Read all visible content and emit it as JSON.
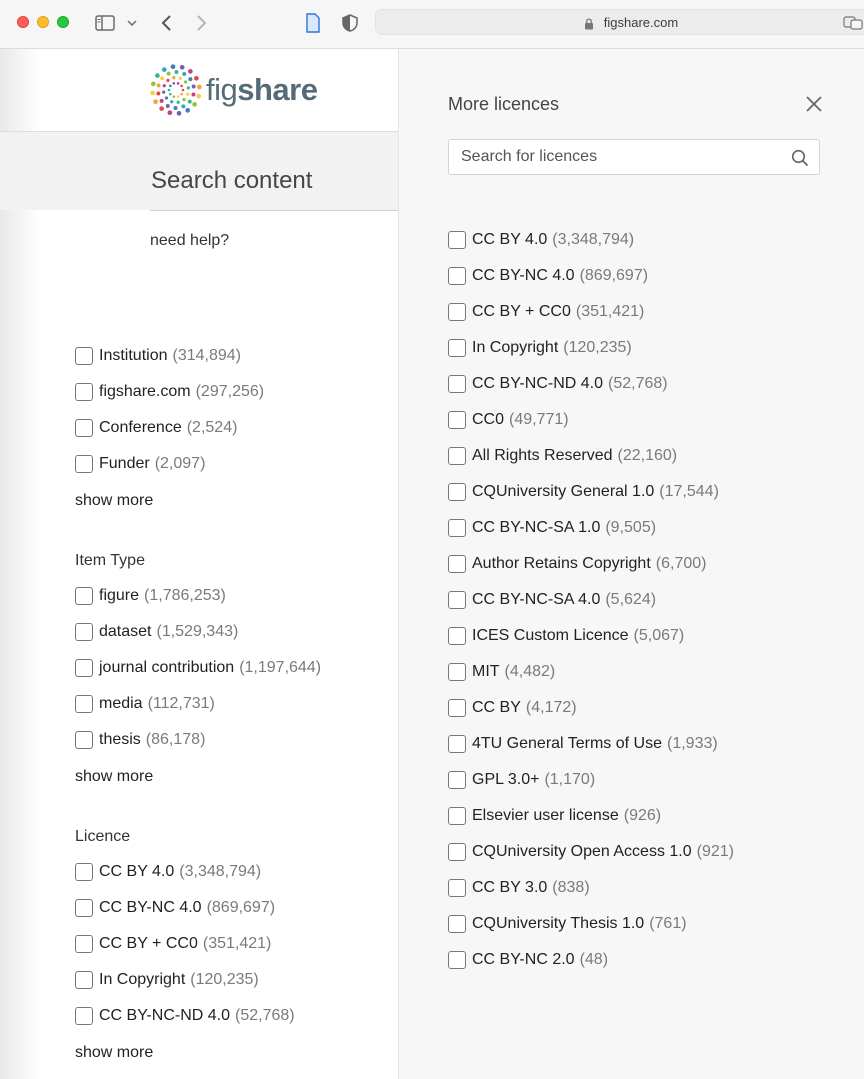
{
  "browser": {
    "url": "figshare.com"
  },
  "logo": {
    "text_fig": "fig",
    "text_share": "share"
  },
  "left": {
    "search_heading": "Search content",
    "need_help": "need help?",
    "source": [
      {
        "label": "Institution",
        "count": "(314,894)"
      },
      {
        "label": "figshare.com",
        "count": "(297,256)"
      },
      {
        "label": "Conference",
        "count": "(2,524)"
      },
      {
        "label": "Funder",
        "count": "(2,097)"
      }
    ],
    "source_show_more": "show more",
    "item_type_title": "Item Type",
    "item_types": [
      {
        "label": "figure",
        "count": "(1,786,253)"
      },
      {
        "label": "dataset",
        "count": "(1,529,343)"
      },
      {
        "label": "journal contribution",
        "count": "(1,197,644)"
      },
      {
        "label": "media",
        "count": "(112,731)"
      },
      {
        "label": "thesis",
        "count": "(86,178)"
      }
    ],
    "item_type_show_more": "show more",
    "licence_title": "Licence",
    "licences": [
      {
        "label": "CC BY 4.0",
        "count": "(3,348,794)"
      },
      {
        "label": "CC BY-NC 4.0",
        "count": "(869,697)"
      },
      {
        "label": "CC BY + CC0",
        "count": "(351,421)"
      },
      {
        "label": "In Copyright",
        "count": "(120,235)"
      },
      {
        "label": "CC BY-NC-ND 4.0",
        "count": "(52,768)"
      }
    ],
    "licence_show_more": "show more"
  },
  "panel": {
    "title": "More licences",
    "search_placeholder": "Search for licences",
    "licences": [
      {
        "label": "CC BY 4.0",
        "count": "(3,348,794)"
      },
      {
        "label": "CC BY-NC 4.0",
        "count": "(869,697)"
      },
      {
        "label": "CC BY + CC0",
        "count": "(351,421)"
      },
      {
        "label": "In Copyright",
        "count": "(120,235)"
      },
      {
        "label": "CC BY-NC-ND 4.0",
        "count": "(52,768)"
      },
      {
        "label": "CC0",
        "count": "(49,771)"
      },
      {
        "label": "All Rights Reserved",
        "count": "(22,160)"
      },
      {
        "label": "CQUniversity General 1.0",
        "count": "(17,544)"
      },
      {
        "label": "CC BY-NC-SA 1.0",
        "count": "(9,505)"
      },
      {
        "label": "Author Retains Copyright",
        "count": "(6,700)"
      },
      {
        "label": "CC BY-NC-SA 4.0",
        "count": "(5,624)"
      },
      {
        "label": "ICES Custom Licence",
        "count": "(5,067)"
      },
      {
        "label": "MIT",
        "count": "(4,482)"
      },
      {
        "label": "CC BY",
        "count": "(4,172)"
      },
      {
        "label": "4TU General Terms of Use",
        "count": "(1,933)"
      },
      {
        "label": "GPL 3.0+",
        "count": "(1,170)"
      },
      {
        "label": "Elsevier user license",
        "count": "(926)"
      },
      {
        "label": "CQUniversity Open Access 1.0",
        "count": "(921)"
      },
      {
        "label": "CC BY 3.0",
        "count": "(838)"
      },
      {
        "label": "CQUniversity Thesis 1.0",
        "count": "(761)"
      },
      {
        "label": "CC BY-NC 2.0",
        "count": "(48)"
      }
    ]
  }
}
